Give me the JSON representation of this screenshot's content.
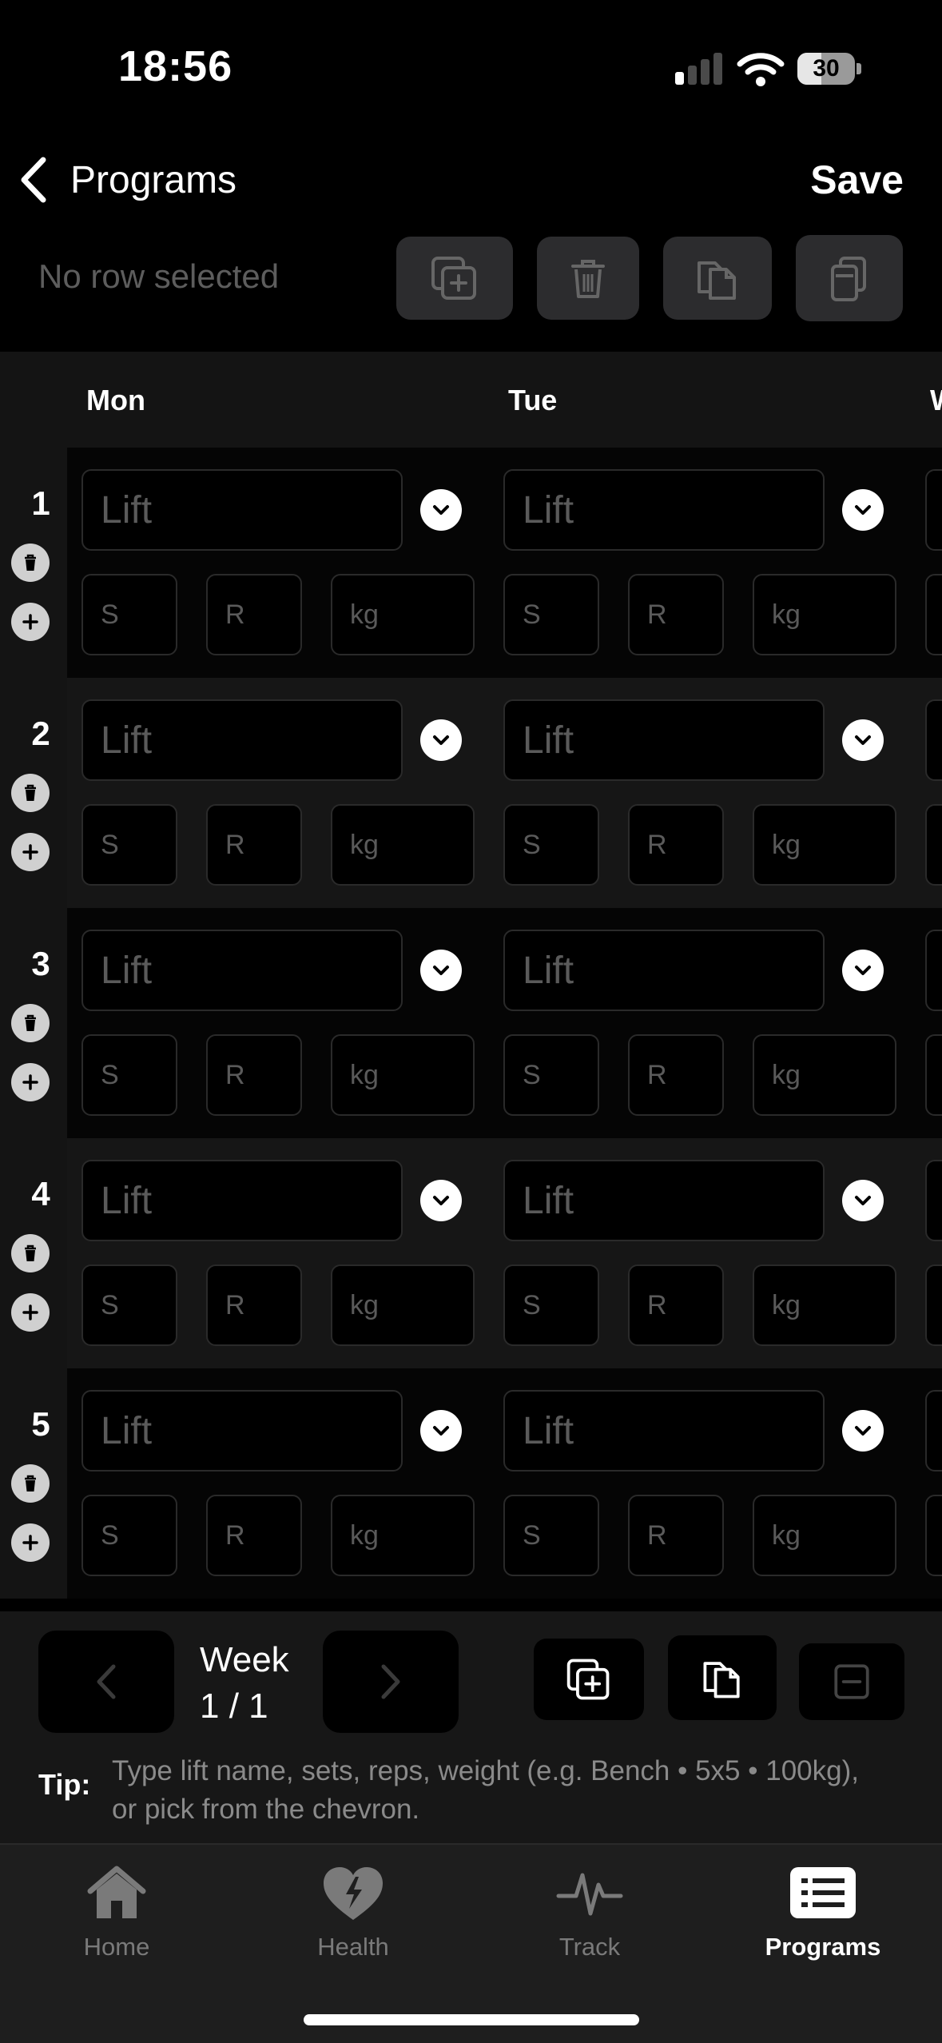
{
  "status_bar": {
    "time": "18:56",
    "battery": "30"
  },
  "nav": {
    "back_label": "Programs",
    "save_label": "Save"
  },
  "toolbar": {
    "selection_status": "No row selected"
  },
  "grid": {
    "days": [
      "Mon",
      "Tue",
      "W"
    ],
    "rows": [
      "1",
      "2",
      "3",
      "4",
      "5"
    ],
    "placeholders": {
      "lift": "Lift",
      "sets": "S",
      "reps": "R",
      "weight": "kg"
    }
  },
  "week": {
    "label": "Week",
    "counter": "1 / 1"
  },
  "tip": {
    "label": "Tip:",
    "text": "Type lift name, sets, reps, weight (e.g. Bench • 5x5 • 100kg), or pick from the chevron."
  },
  "tabs": [
    {
      "label": "Home",
      "icon": "house-icon",
      "active": false
    },
    {
      "label": "Health",
      "icon": "heart-bolt-icon",
      "active": false
    },
    {
      "label": "Track",
      "icon": "pulse-icon",
      "active": false
    },
    {
      "label": "Programs",
      "icon": "list-card-icon",
      "active": true
    }
  ]
}
